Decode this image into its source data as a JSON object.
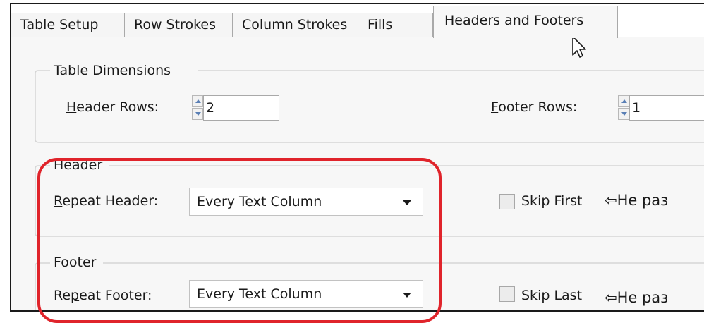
{
  "tabs": [
    {
      "label": "Table Setup",
      "active": false
    },
    {
      "label": "Row Strokes",
      "active": false
    },
    {
      "label": "Column Strokes",
      "active": false
    },
    {
      "label": "Fills",
      "active": false
    },
    {
      "label": "Headers and Footers",
      "active": true
    }
  ],
  "table_dimensions": {
    "group_title": "Table Dimensions",
    "header_rows": {
      "mnemonic": "H",
      "label_rest": "eader Rows:",
      "value": "2"
    },
    "footer_rows": {
      "mnemonic": "F",
      "label_rest": "ooter Rows:",
      "value": "1"
    }
  },
  "header": {
    "group_title": "Header",
    "repeat": {
      "mnemonic": "R",
      "label_rest": "epeat Header:",
      "selected": "Every Text Column"
    },
    "skip": {
      "label": "Skip First",
      "checked": false
    },
    "note": "⇦Не раз"
  },
  "footer": {
    "group_title": "Footer",
    "repeat": {
      "label_pre": "Re",
      "mnemonic": "p",
      "label_rest": "eat Footer:",
      "selected": "Every Text Column"
    },
    "skip": {
      "label": "Skip Last",
      "checked": false
    },
    "note": "⇦Не раз"
  },
  "colors": {
    "highlight": "#e0242b",
    "spinner_arrow": "#5a7fb5",
    "panel": "#f7f7f7",
    "border": "#a9a9a9"
  },
  "icons": [
    "spinner-up-icon",
    "spinner-down-icon",
    "dropdown-arrow-icon",
    "mouse-pointer-icon"
  ]
}
